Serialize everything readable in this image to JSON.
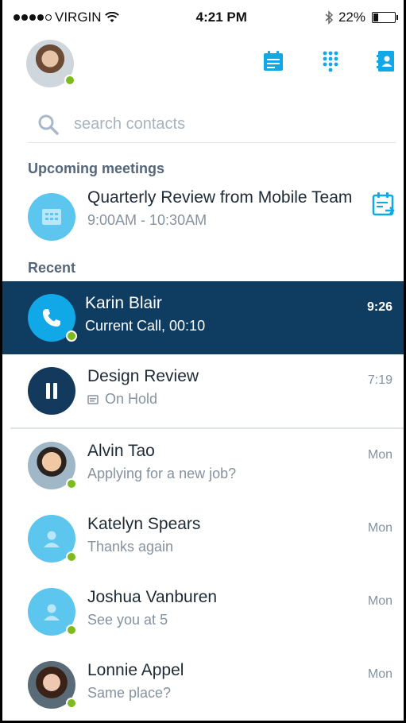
{
  "status_bar": {
    "carrier": "VIRGIN",
    "time": "4:21 PM",
    "battery": "22%",
    "battery_level": 0.22
  },
  "header": {
    "icons": [
      "calendar-notes-icon",
      "dialpad-icon",
      "contacts-icon"
    ]
  },
  "search": {
    "placeholder": "search contacts"
  },
  "sections": {
    "upcoming": "Upcoming meetings",
    "recent": "Recent"
  },
  "meeting": {
    "title": "Quarterly Review from Mobile Team",
    "time": "9:00AM - 10:30AM"
  },
  "recent": [
    {
      "name": "Karin Blair",
      "sub": "Current Call, 00:10",
      "time": "9:26"
    },
    {
      "name": "Design Review",
      "sub": "On Hold",
      "time": "7:19"
    },
    {
      "name": "Alvin Tao",
      "sub": "Applying for a new job?",
      "time": "Mon"
    },
    {
      "name": "Katelyn Spears",
      "sub": "Thanks again",
      "time": "Mon"
    },
    {
      "name": "Joshua Vanburen",
      "sub": "See you at 5",
      "time": "Mon"
    },
    {
      "name": "Lonnie Appel",
      "sub": "Same place?",
      "time": "Mon"
    }
  ],
  "colors": {
    "accent": "#10a8e6",
    "active_row": "#0f3d61",
    "presence": "#7dba1b",
    "avatar_light": "#5cc6ee"
  }
}
